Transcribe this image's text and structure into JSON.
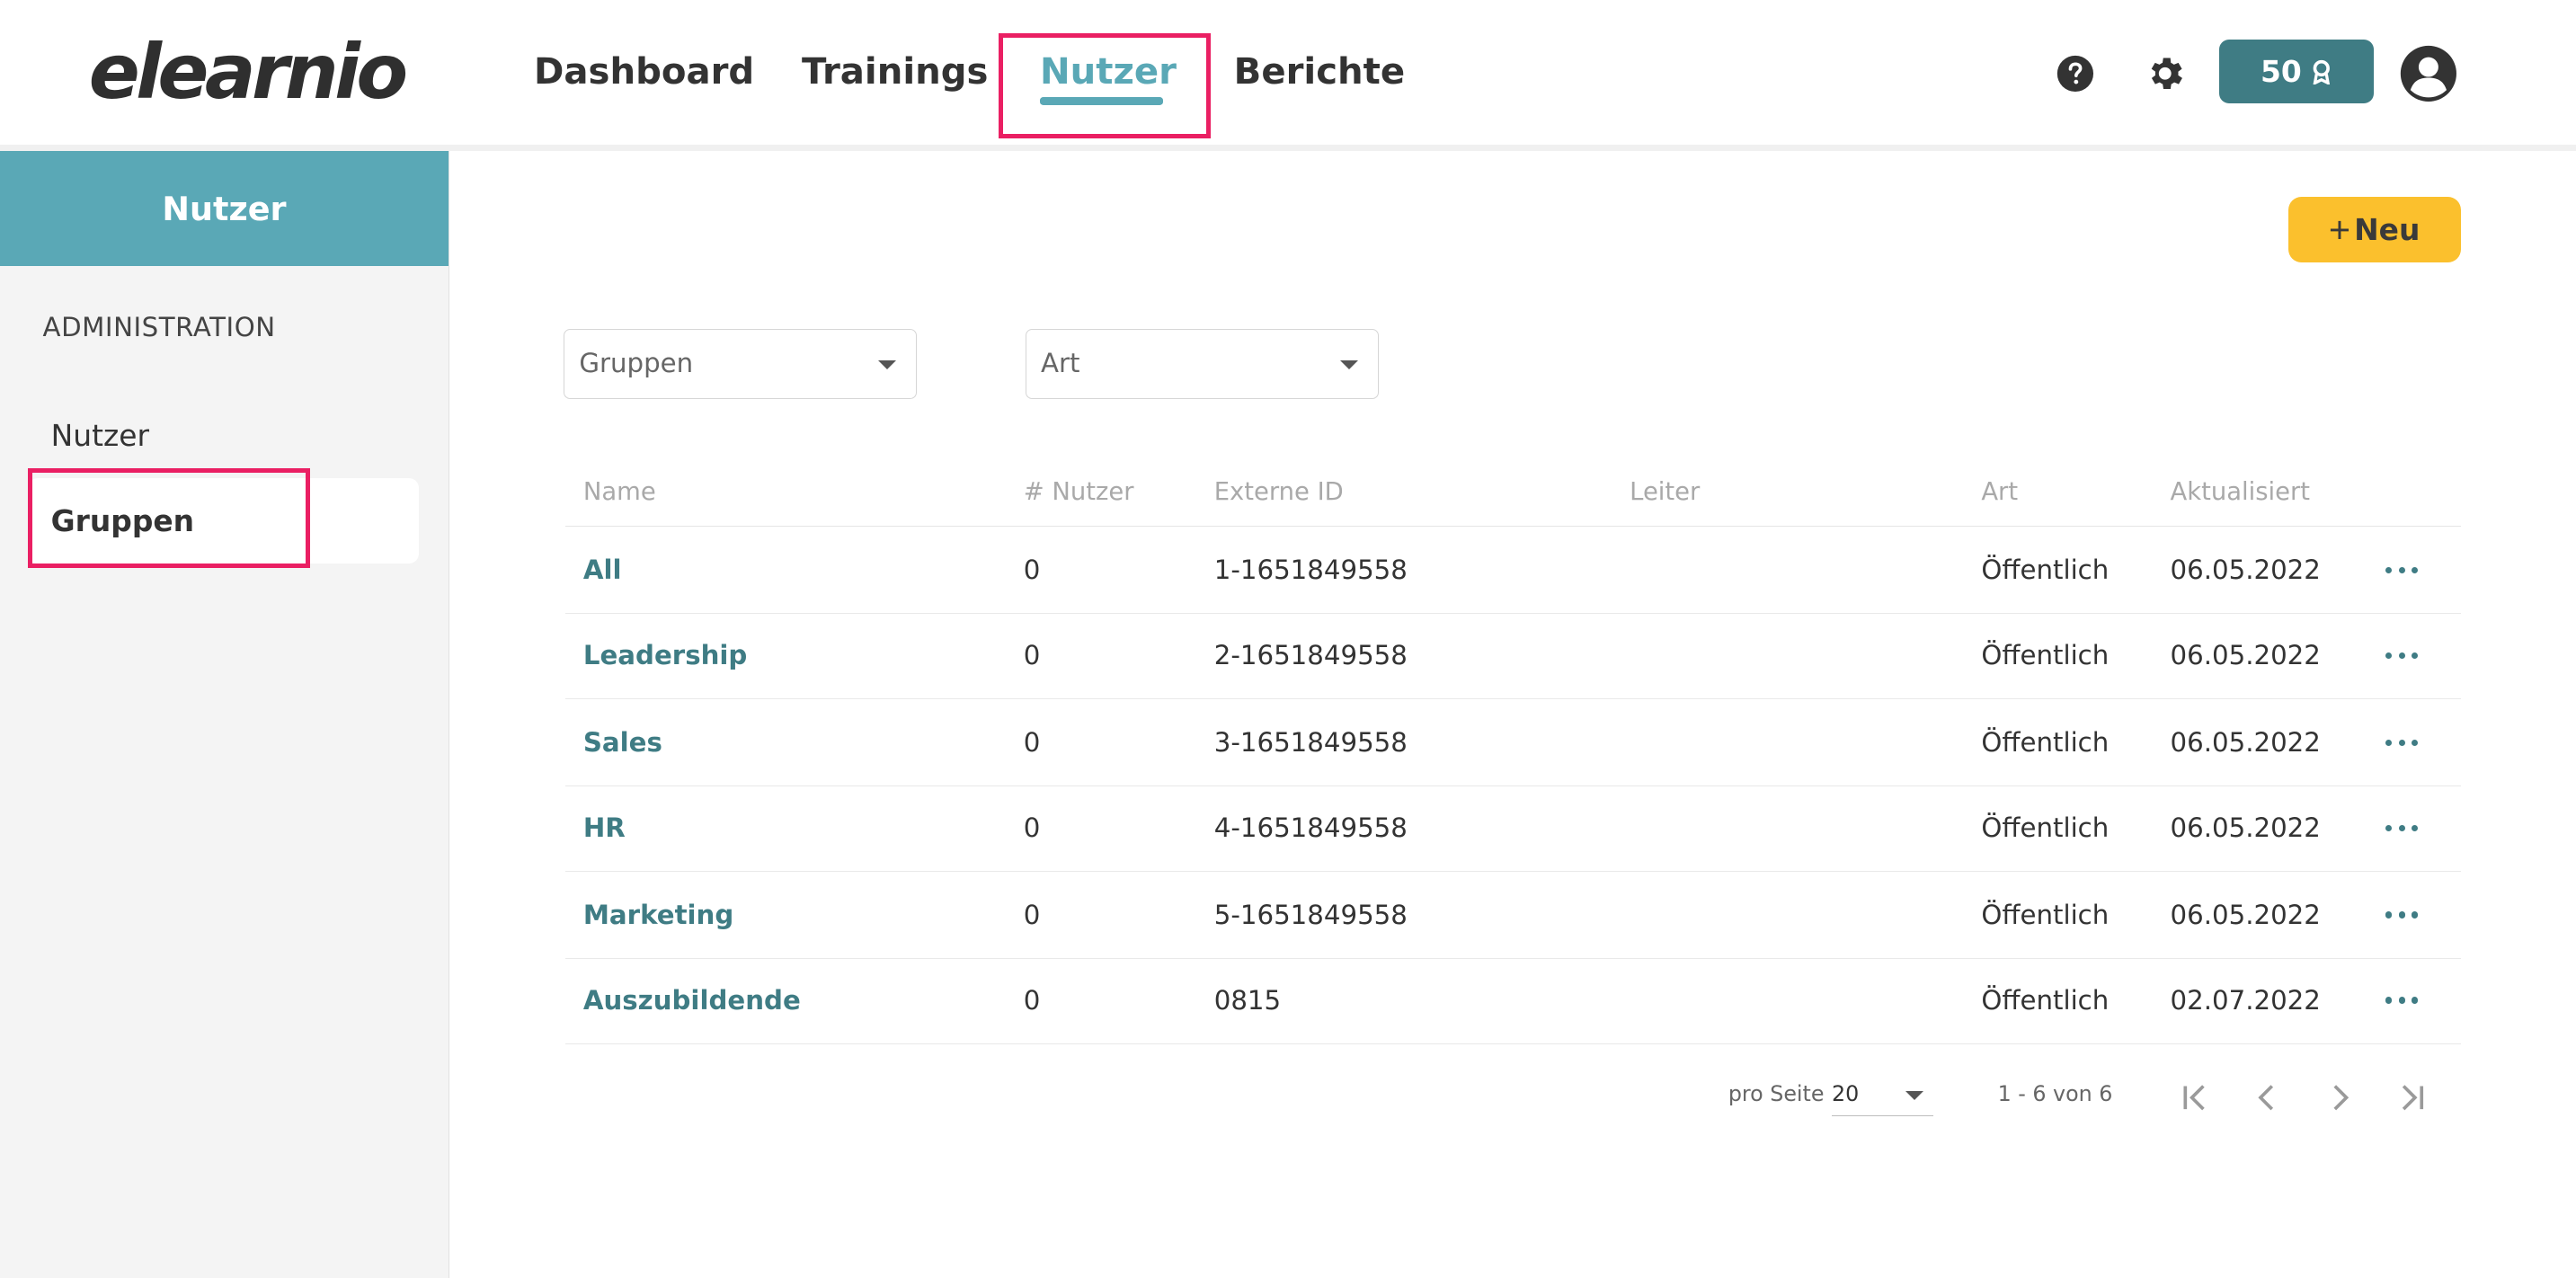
{
  "brand": {
    "logo_text": "elearnio"
  },
  "topnav": {
    "items": [
      {
        "label": "Dashboard",
        "active": false
      },
      {
        "label": "Trainings",
        "active": false
      },
      {
        "label": "Nutzer",
        "active": true
      },
      {
        "label": "Berichte",
        "active": false
      }
    ],
    "accent_color": "#5aa8b6"
  },
  "header_actions": {
    "help_icon": "help-circle-icon",
    "settings_icon": "gear-icon",
    "credits_value": "50",
    "credits_icon": "award-icon",
    "profile_icon": "user-avatar-icon"
  },
  "sidebar": {
    "title": "Nutzer",
    "section_label": "ADMINISTRATION",
    "items": [
      {
        "label": "Nutzer",
        "active": false
      },
      {
        "label": "Gruppen",
        "active": true
      }
    ]
  },
  "toolbar": {
    "new_label": "Neu",
    "new_icon": "plus-icon",
    "new_color": "#fbc02d"
  },
  "filters": {
    "group_placeholder": "Gruppen",
    "type_placeholder": "Art"
  },
  "table": {
    "columns": [
      "Name",
      "# Nutzer",
      "Externe ID",
      "Leiter",
      "Art",
      "Aktualisiert"
    ],
    "rows": [
      {
        "name": "All",
        "users": "0",
        "external_id": "1-1651849558",
        "leader": "",
        "type": "Öffentlich",
        "updated": "06.05.2022"
      },
      {
        "name": "Leadership",
        "users": "0",
        "external_id": "2-1651849558",
        "leader": "",
        "type": "Öffentlich",
        "updated": "06.05.2022"
      },
      {
        "name": "Sales",
        "users": "0",
        "external_id": "3-1651849558",
        "leader": "",
        "type": "Öffentlich",
        "updated": "06.05.2022"
      },
      {
        "name": "HR",
        "users": "0",
        "external_id": "4-1651849558",
        "leader": "",
        "type": "Öffentlich",
        "updated": "06.05.2022"
      },
      {
        "name": "Marketing",
        "users": "0",
        "external_id": "5-1651849558",
        "leader": "",
        "type": "Öffentlich",
        "updated": "06.05.2022"
      },
      {
        "name": "Auszubildende",
        "users": "0",
        "external_id": "0815",
        "leader": "",
        "type": "Öffentlich",
        "updated": "02.07.2022"
      }
    ],
    "row_menu_icon": "more-horizontal-icon"
  },
  "pagination": {
    "per_page_label": "pro Seite",
    "per_page_value": "20",
    "range_text": "1 - 6 von 6",
    "icons": [
      "first-page-icon",
      "prev-page-icon",
      "next-page-icon",
      "last-page-icon"
    ]
  },
  "highlight_color": "#ea1f63"
}
